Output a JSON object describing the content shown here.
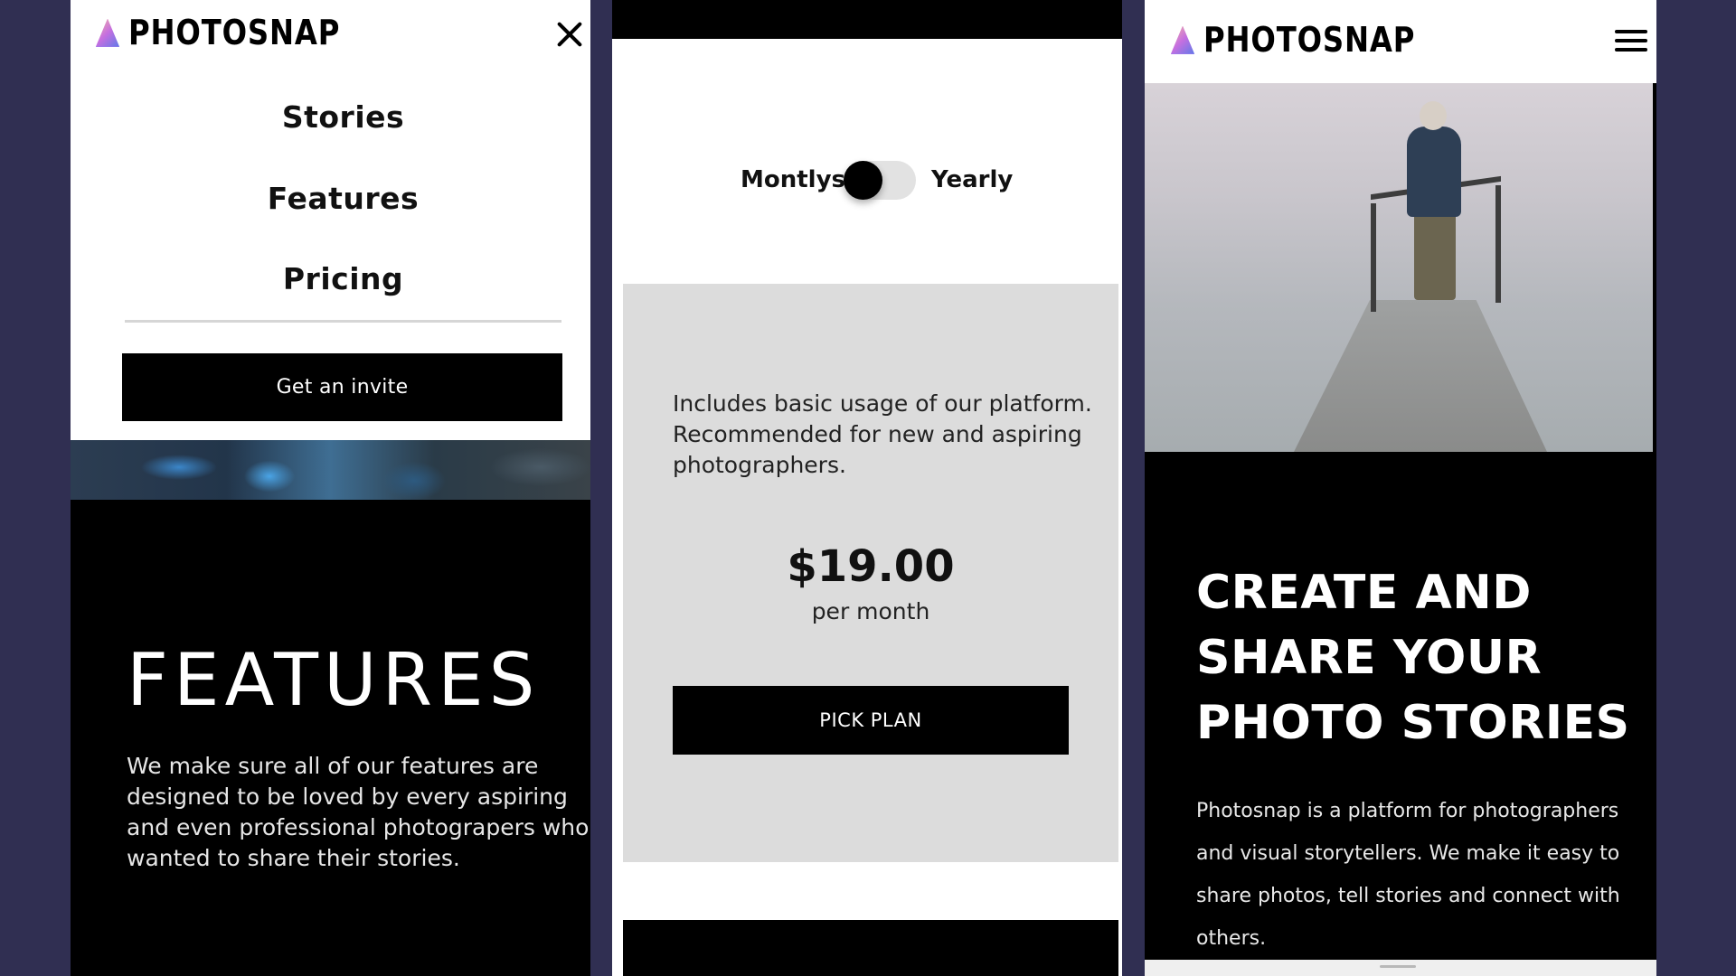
{
  "brand": {
    "logo_text": "PHOTOSNAP"
  },
  "menu": {
    "items": [
      {
        "label": "Stories"
      },
      {
        "label": "Features"
      },
      {
        "label": "Pricing"
      }
    ],
    "invite_label": "Get an invite"
  },
  "features": {
    "title": "FEATURES",
    "description": "We make sure all of our features are designed to be loved by every aspiring and even professional photograpers who wanted to share their stories."
  },
  "pricing": {
    "toggle": {
      "left_label": "Montlys",
      "right_label": "Yearly",
      "selected": "Montlys"
    },
    "plan": {
      "description": "Includes basic usage of our platform. Recommended for new and aspiring photographers.",
      "price": "$19.00",
      "period": "per month",
      "button_label": "PICK PLAN"
    }
  },
  "hero": {
    "title": "CREATE AND SHARE YOUR PHOTO STORIES",
    "description": "Photosnap is a platform for photographers and visual storytellers. We make it easy to share photos, tell stories and connect with others."
  },
  "colors": {
    "background": "#302f52",
    "dark": "#000000",
    "card": "#dcdcdc"
  },
  "icons": [
    "logo-triangle-icon",
    "close-icon",
    "hamburger-icon"
  ]
}
